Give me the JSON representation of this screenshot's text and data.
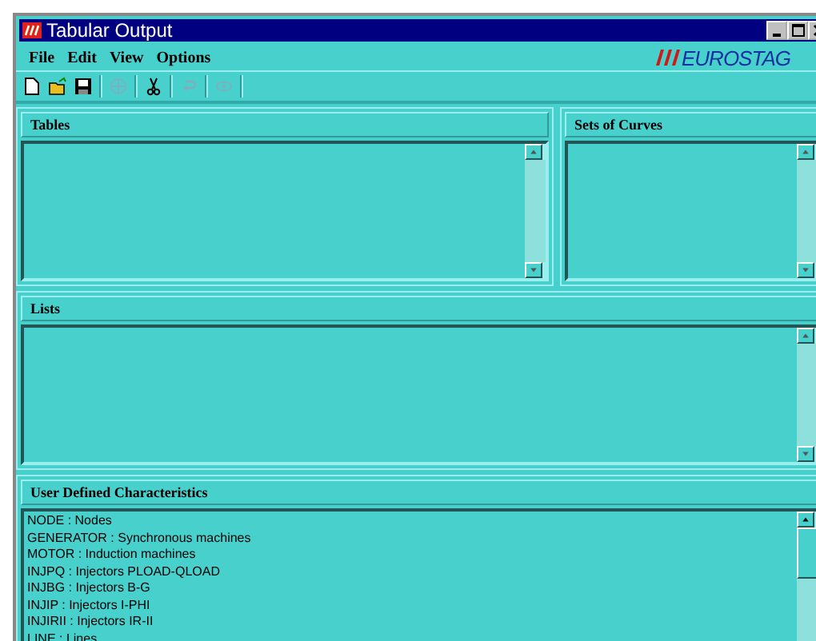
{
  "window": {
    "title": "Tabular Output"
  },
  "menu": [
    "File",
    "Edit",
    "View",
    "Options"
  ],
  "brand": "EUROSTAG",
  "toolbar": [
    {
      "kind": "new",
      "disabled": false
    },
    {
      "kind": "open",
      "disabled": false
    },
    {
      "kind": "save",
      "disabled": false
    },
    {
      "kind": "sep"
    },
    {
      "kind": "globe",
      "disabled": true
    },
    {
      "kind": "sep"
    },
    {
      "kind": "cut",
      "disabled": false
    },
    {
      "kind": "sep"
    },
    {
      "kind": "undo",
      "disabled": true
    },
    {
      "kind": "sep"
    },
    {
      "kind": "eye",
      "disabled": true
    },
    {
      "kind": "sep"
    }
  ],
  "tables": {
    "title": "Tables"
  },
  "sets_of_curves": {
    "title": "Sets of Curves"
  },
  "lists": {
    "title": "Lists"
  },
  "user_defined": {
    "title": "User Defined Characteristics",
    "items": [
      "NODE : Nodes",
      "GENERATOR : Synchronous machines",
      "MOTOR : Induction machines",
      "INJPQ : Injectors PLOAD-QLOAD",
      "INJBG : Injectors B-G",
      "INJIP : Injectors I-PHI",
      "INJIRII : Injectors IR-II",
      "LINE : Lines"
    ]
  }
}
